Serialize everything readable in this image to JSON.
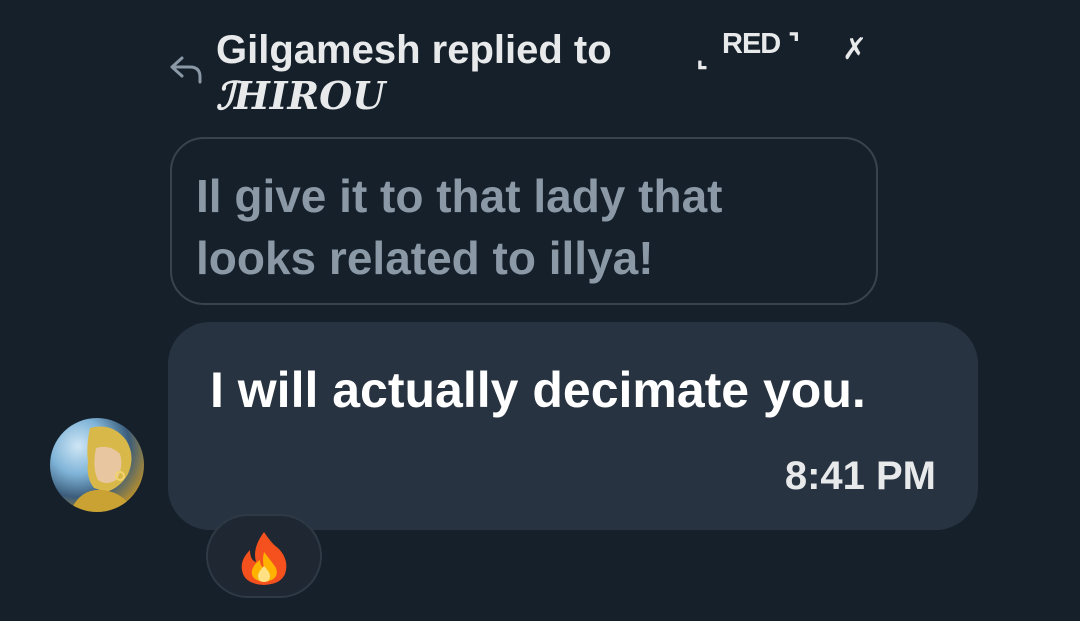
{
  "reply": {
    "text": "Gilgamesh replied to",
    "recipient_tag": "RED",
    "recipient_tag_corner_left": "⌞",
    "recipient_tag_corner_right": "⌝",
    "recipient_mark": "✗",
    "recipient_name": "ℐHIROU"
  },
  "quoted_message": {
    "text": "Il give it to that lady that looks related to illya!"
  },
  "message": {
    "text": "I will actually decimate you.",
    "time": "8:41 PM"
  },
  "reaction": {
    "emoji_icon": "fire-icon"
  },
  "colors": {
    "background": "#15202b",
    "bubble": "#273340",
    "quoted_text": "#8b98a5",
    "quoted_border": "#38444d"
  }
}
